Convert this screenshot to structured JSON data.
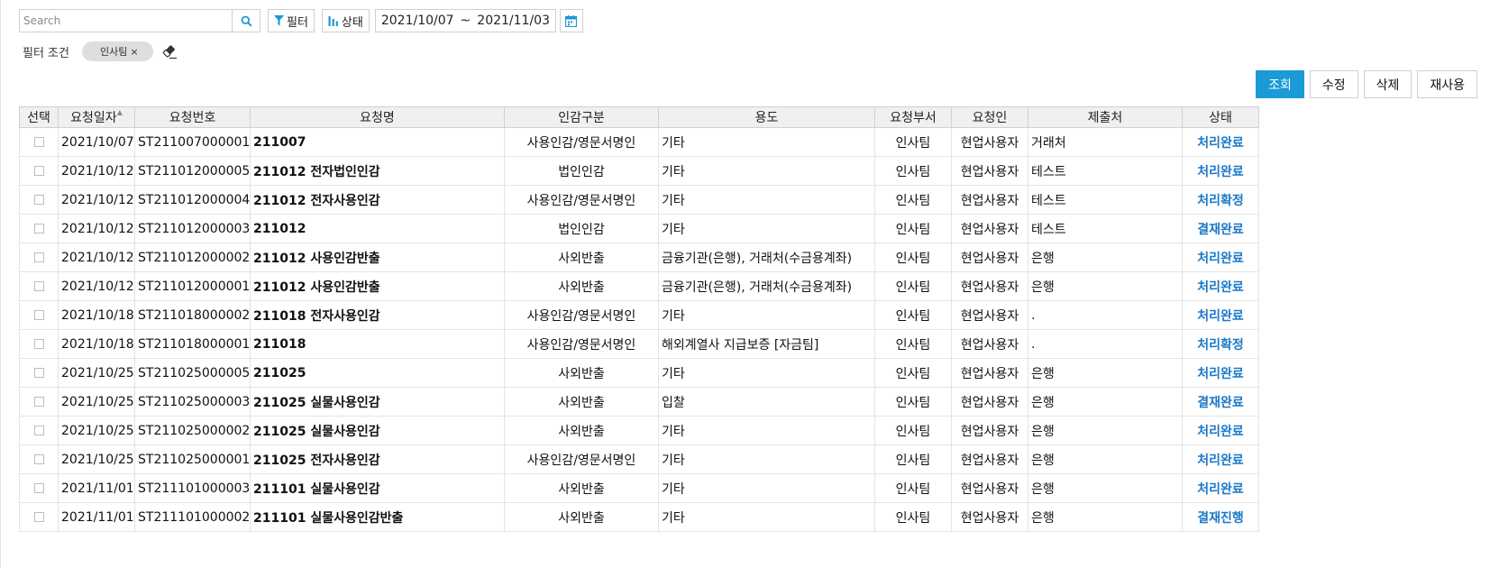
{
  "toolbar": {
    "search_placeholder": "Search",
    "filter_label": "필터",
    "status_label": "상태",
    "date_from": "2021/10/07",
    "date_sep": "~",
    "date_to": "2021/11/03"
  },
  "filter": {
    "label": "필터 조건",
    "chip": "인사팀",
    "chip_close": "×"
  },
  "actions": {
    "view": "조회",
    "edit": "수정",
    "delete": "삭제",
    "reuse": "재사용"
  },
  "colors": {
    "primary": "#1a9ad6",
    "status": "#1a78c8"
  },
  "table": {
    "sort_indicator": "▲",
    "columns": {
      "select": "선택",
      "date": "요청일자",
      "number": "요청번호",
      "name": "요청명",
      "seal_type": "인감구분",
      "purpose": "용도",
      "dept": "요청부서",
      "requester": "요청인",
      "submit_to": "제출처",
      "status": "상태"
    },
    "rows": [
      {
        "date": "2021/10/07",
        "number": "ST211007000001",
        "name": "211007",
        "seal_type": "사용인감/영문서명인",
        "purpose": "기타",
        "dept": "인사팀",
        "requester": "현업사용자",
        "submit_to": "거래처",
        "status": "처리완료"
      },
      {
        "date": "2021/10/12",
        "number": "ST211012000005",
        "name": "211012 전자법인인감",
        "seal_type": "법인인감",
        "purpose": "기타",
        "dept": "인사팀",
        "requester": "현업사용자",
        "submit_to": "테스트",
        "status": "처리완료"
      },
      {
        "date": "2021/10/12",
        "number": "ST211012000004",
        "name": "211012 전자사용인감",
        "seal_type": "사용인감/영문서명인",
        "purpose": "기타",
        "dept": "인사팀",
        "requester": "현업사용자",
        "submit_to": "테스트",
        "status": "처리확정"
      },
      {
        "date": "2021/10/12",
        "number": "ST211012000003",
        "name": "211012",
        "seal_type": "법인인감",
        "purpose": "기타",
        "dept": "인사팀",
        "requester": "현업사용자",
        "submit_to": "테스트",
        "status": "결재완료"
      },
      {
        "date": "2021/10/12",
        "number": "ST211012000002",
        "name": "211012 사용인감반출",
        "seal_type": "사외반출",
        "purpose": "금융기관(은행), 거래처(수금용계좌)",
        "dept": "인사팀",
        "requester": "현업사용자",
        "submit_to": "은행",
        "status": "처리완료"
      },
      {
        "date": "2021/10/12",
        "number": "ST211012000001",
        "name": "211012 사용인감반출",
        "seal_type": "사외반출",
        "purpose": "금융기관(은행), 거래처(수금용계좌)",
        "dept": "인사팀",
        "requester": "현업사용자",
        "submit_to": "은행",
        "status": "처리완료"
      },
      {
        "date": "2021/10/18",
        "number": "ST211018000002",
        "name": "211018 전자사용인감",
        "seal_type": "사용인감/영문서명인",
        "purpose": "기타",
        "dept": "인사팀",
        "requester": "현업사용자",
        "submit_to": ".",
        "status": "처리완료"
      },
      {
        "date": "2021/10/18",
        "number": "ST211018000001",
        "name": "211018",
        "seal_type": "사용인감/영문서명인",
        "purpose": "해외계열사 지급보증 [자금팀]",
        "dept": "인사팀",
        "requester": "현업사용자",
        "submit_to": ".",
        "status": "처리확정"
      },
      {
        "date": "2021/10/25",
        "number": "ST211025000005",
        "name": "211025",
        "seal_type": "사외반출",
        "purpose": "기타",
        "dept": "인사팀",
        "requester": "현업사용자",
        "submit_to": "은행",
        "status": "처리완료"
      },
      {
        "date": "2021/10/25",
        "number": "ST211025000003",
        "name": "211025 실물사용인감",
        "seal_type": "사외반출",
        "purpose": "입찰",
        "dept": "인사팀",
        "requester": "현업사용자",
        "submit_to": "은행",
        "status": "결재완료"
      },
      {
        "date": "2021/10/25",
        "number": "ST211025000002",
        "name": "211025 실물사용인감",
        "seal_type": "사외반출",
        "purpose": "기타",
        "dept": "인사팀",
        "requester": "현업사용자",
        "submit_to": "은행",
        "status": "처리완료"
      },
      {
        "date": "2021/10/25",
        "number": "ST211025000001",
        "name": "211025 전자사용인감",
        "seal_type": "사용인감/영문서명인",
        "purpose": "기타",
        "dept": "인사팀",
        "requester": "현업사용자",
        "submit_to": "은행",
        "status": "처리완료"
      },
      {
        "date": "2021/11/01",
        "number": "ST211101000003",
        "name": "211101 실물사용인감",
        "seal_type": "사외반출",
        "purpose": "기타",
        "dept": "인사팀",
        "requester": "현업사용자",
        "submit_to": "은행",
        "status": "처리완료"
      },
      {
        "date": "2021/11/01",
        "number": "ST211101000002",
        "name": "211101 실물사용인감반출",
        "seal_type": "사외반출",
        "purpose": "기타",
        "dept": "인사팀",
        "requester": "현업사용자",
        "submit_to": "은행",
        "status": "결재진행"
      }
    ]
  }
}
